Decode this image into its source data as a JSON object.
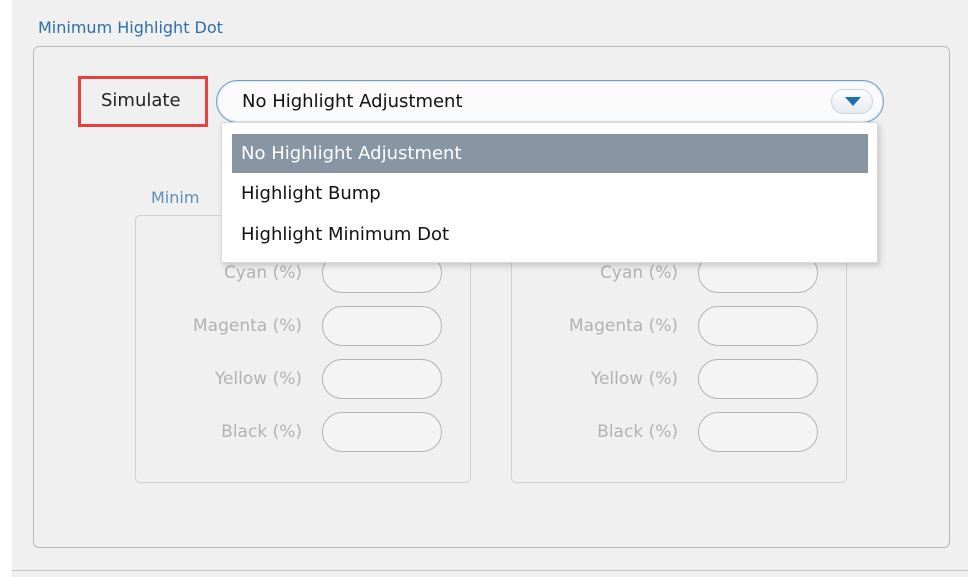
{
  "section": {
    "title": "Minimum Highlight Dot"
  },
  "simulate": {
    "label": "Simulate",
    "selected": "No Highlight Adjustment",
    "options": [
      "No Highlight Adjustment",
      "Highlight Bump",
      "Highlight Minimum Dot"
    ]
  },
  "subgroup": {
    "title_visible": "Minim"
  },
  "left_group": {
    "fields": [
      {
        "label": "Cyan (%)",
        "value": ""
      },
      {
        "label": "Magenta (%)",
        "value": ""
      },
      {
        "label": "Yellow (%)",
        "value": ""
      },
      {
        "label": "Black (%)",
        "value": ""
      }
    ]
  },
  "right_group": {
    "fields": [
      {
        "label": "Cyan (%)",
        "value": ""
      },
      {
        "label": "Magenta (%)",
        "value": ""
      },
      {
        "label": "Yellow (%)",
        "value": ""
      },
      {
        "label": "Black (%)",
        "value": ""
      }
    ]
  },
  "colors": {
    "accent": "#2f6fa8",
    "highlight": "#e8403f",
    "selected_item": "#8896a3"
  },
  "icons": {
    "combo_arrow": "chevron-down-icon"
  }
}
